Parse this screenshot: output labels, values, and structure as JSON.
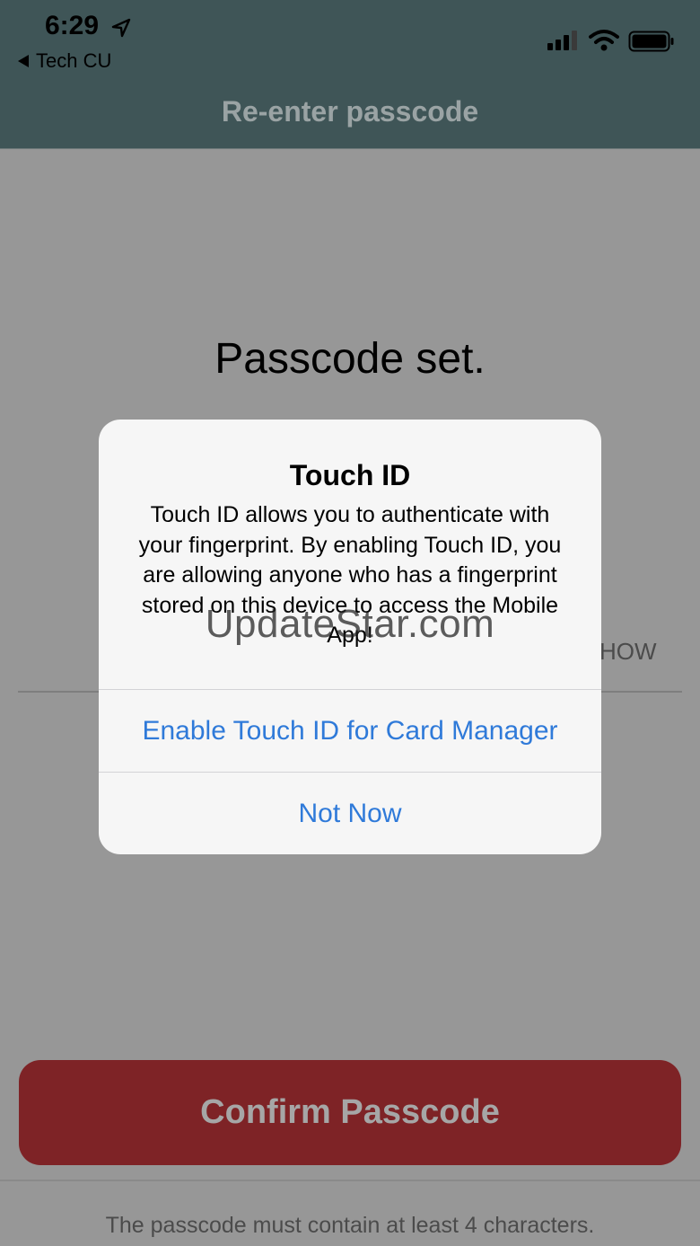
{
  "status_bar": {
    "time": "6:29",
    "back_label": "Tech CU",
    "icons": [
      "location-arrow-icon",
      "cellular-signal-icon",
      "wifi-icon",
      "battery-icon"
    ]
  },
  "header": {
    "title": "Re-enter passcode"
  },
  "main": {
    "title": "Passcode set.",
    "show_label": "HOW",
    "confirm_button": "Confirm Passcode",
    "hint": "The passcode must contain at least 4 characters."
  },
  "alert": {
    "title": "Touch ID",
    "message": "Touch ID allows you to authenticate with your fingerprint. By enabling Touch ID, you are allowing anyone who has a fingerprint stored on this device to access the Mobile App!",
    "primary_action": "Enable Touch ID for Card Manager",
    "secondary_action": "Not Now"
  },
  "watermark": "UpdateStar.com",
  "colors": {
    "header_bg": "#3f5557",
    "dimmed_bg": "#979797",
    "confirm_bg": "#7e2326",
    "alert_action": "#2f7ad9"
  }
}
